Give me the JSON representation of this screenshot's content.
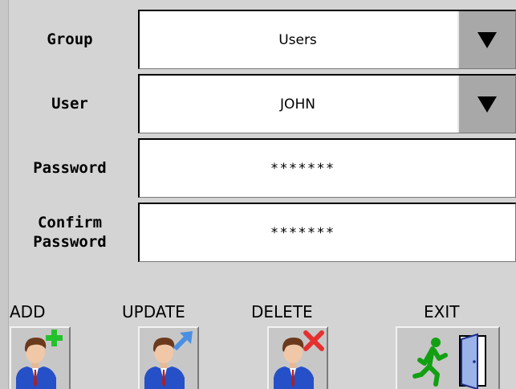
{
  "form": {
    "group": {
      "label": "Group",
      "value": "Users"
    },
    "user": {
      "label": "User",
      "value": "JOHN"
    },
    "password": {
      "label": "Password",
      "value": "*******"
    },
    "confirm": {
      "label": "Confirm\nPassword",
      "value": "*******"
    }
  },
  "actions": {
    "add_label": "ADD",
    "update_label": "UPDATE",
    "delete_label": "DELETE",
    "exit_label": "EXIT"
  },
  "icons": {
    "add": "user-add-icon",
    "update": "user-update-icon",
    "delete": "user-delete-icon",
    "exit": "exit-door-icon"
  },
  "colors": {
    "background": "#d4d4d4",
    "field": "#ffffff",
    "dropdown_button": "#a8a8a8",
    "add_plus": "#22c22c",
    "update_arrow": "#4a90e2",
    "delete_x": "#e53030",
    "exit_runner": "#12a012"
  }
}
